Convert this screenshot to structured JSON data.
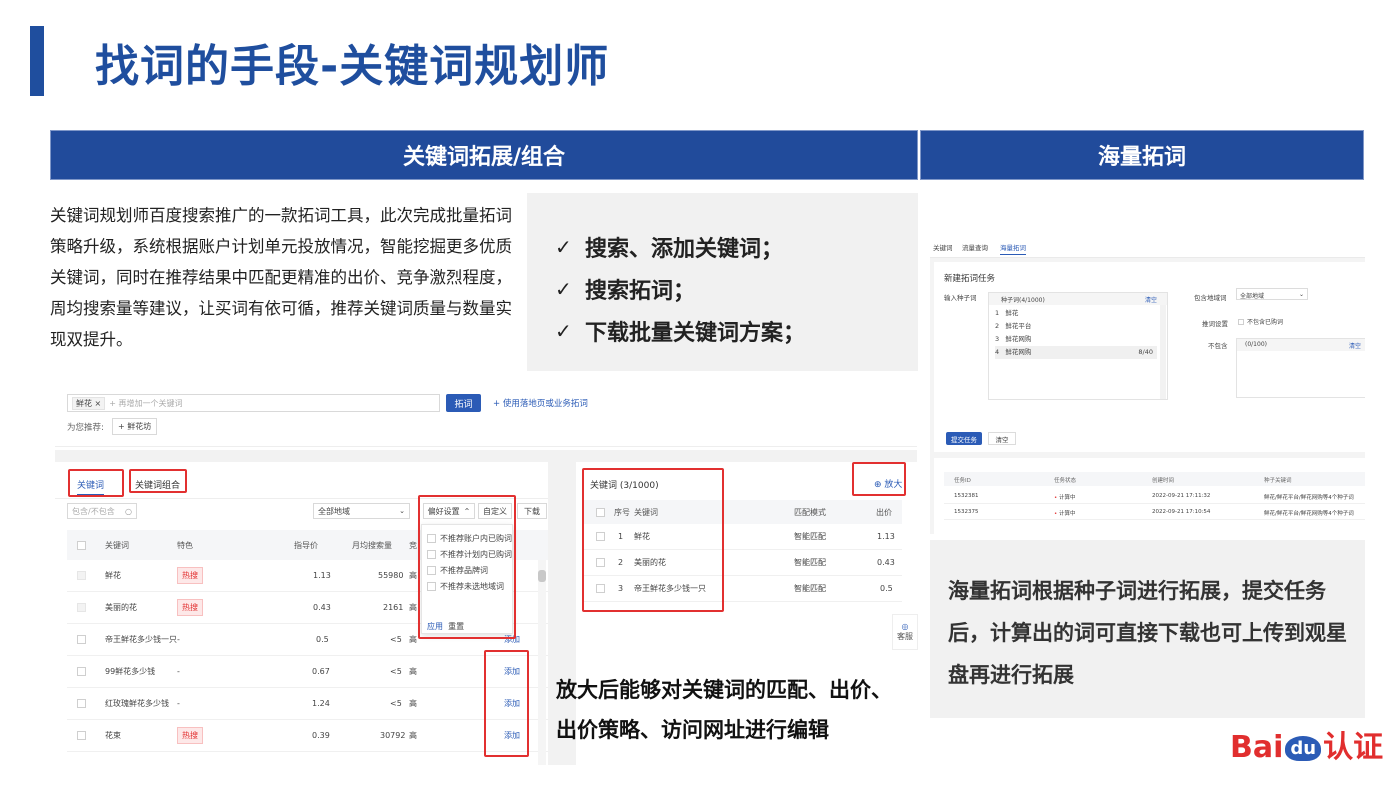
{
  "title": "找词的手段-关键词规划师",
  "sections": {
    "left_header": "关键词拓展/组合",
    "right_header": "海量拓词"
  },
  "description": "关键词规划师百度搜索推广的一款拓词工具，此次完成批量拓词策略升级，系统根据账户计划单元投放情况，智能挖掘更多优质关键词，同时在推荐结果中匹配更精准的出价、竞争激烈程度，周均搜索量等建议，让买词有依可循，推荐关键词质量与数量实现双提升。",
  "features": [
    "搜索、添加关键词；",
    "搜索拓词；",
    "下载批量关键词方案；"
  ],
  "check_mark": "✓",
  "search_panel": {
    "tag": "鲜花",
    "tag_close": "×",
    "placeholder": "+ 再增加一个关键词",
    "expand_button": "拓词",
    "landing_link": "+ 使用落地页或业务拓词",
    "recommend_label": "为您推荐:",
    "recommend_chip": "+ 鲜花坊"
  },
  "left_table": {
    "tabs": [
      "关键词",
      "关键词组合"
    ],
    "filter_placeholder": "包含/不包含",
    "region_select": "全部地域",
    "pref_button": "偏好设置",
    "custom_button": "自定义",
    "download_button": "下载",
    "columns": [
      "关键词",
      "特色",
      "指导价",
      "月均搜索量",
      "竞"
    ],
    "rows": [
      {
        "kw": "鲜花",
        "tag": "热搜",
        "price": "1.13",
        "vol": "55980",
        "comp": "高",
        "action": ""
      },
      {
        "kw": "美丽的花",
        "tag": "热搜",
        "price": "0.43",
        "vol": "2161",
        "comp": "高",
        "action": ""
      },
      {
        "kw": "帝王鲜花多少钱一只",
        "tag": "-",
        "price": "0.5",
        "vol": "<5",
        "comp": "高",
        "action": "添加"
      },
      {
        "kw": "99鲜花多少钱",
        "tag": "-",
        "price": "0.67",
        "vol": "<5",
        "comp": "高",
        "action": "添加"
      },
      {
        "kw": "红玫瑰鲜花多少钱",
        "tag": "-",
        "price": "1.24",
        "vol": "<5",
        "comp": "高",
        "action": "添加"
      },
      {
        "kw": "花束",
        "tag": "热搜",
        "price": "0.39",
        "vol": "30792",
        "comp": "高",
        "action": "添加"
      }
    ],
    "dropdown": {
      "options": [
        "不推荐账户内已购词",
        "不推荐计划内已购词",
        "不推荐品牌词",
        "不推荐未选地域词"
      ],
      "apply": "应用",
      "reset": "重置"
    }
  },
  "right_table": {
    "title": "关键词",
    "count": "(3/1000)",
    "zoom": "放大",
    "columns": [
      "序号",
      "关键词",
      "匹配模式",
      "出价"
    ],
    "rows": [
      {
        "no": "1",
        "kw": "鲜花",
        "match": "智能匹配",
        "bid": "1.13"
      },
      {
        "no": "2",
        "kw": "美丽的花",
        "match": "智能匹配",
        "bid": "0.43"
      },
      {
        "no": "3",
        "kw": "帝王鲜花多少钱一只",
        "match": "智能匹配",
        "bid": "0.5"
      }
    ],
    "service": "客服"
  },
  "bottom_note_lines": [
    "放大后能够对关键词的匹配、出价、",
    "出价策略、访问网址进行编辑"
  ],
  "mass_panel": {
    "tabs": [
      "关键词",
      "流量查询",
      "海量拓词"
    ],
    "heading": "新建拓词任务",
    "seed_label": "输入种子词",
    "seed_header": "种子词(4/1000)",
    "seed_clear": "清空",
    "seeds": [
      "鲜花",
      "鲜花平台",
      "鲜花网购",
      "鲜花网购"
    ],
    "seed_count": "8/40",
    "region_label": "包含地域词",
    "region_value": "全部地域",
    "setting_label": "推词设置",
    "setting_option": "不包含已购词",
    "exclude_label": "不包含",
    "exclude_count": "(0/100)",
    "exclude_clear": "清空",
    "submit": "提交任务",
    "clear": "清空",
    "task_columns": [
      "任务ID",
      "任务状态",
      "创建时间",
      "种子关键词"
    ],
    "tasks": [
      {
        "id": "1532381",
        "status": "计算中",
        "time": "2022-09-21 17:11:32",
        "seeds": "鲜花/鲜花平台/鲜花网购等4个种子词"
      },
      {
        "id": "1532375",
        "status": "计算中",
        "time": "2022-09-21 17:10:54",
        "seeds": "鲜花/鲜花平台/鲜花网购等4个种子词"
      }
    ]
  },
  "right_note": "海量拓词根据种子词进行拓展，提交任务后，计算出的词可直接下载也可上传到观星盘再进行拓展",
  "logo": {
    "bai": "Bai",
    "du": "du",
    "cert": "认证"
  },
  "colors": {
    "brand_blue": "#214b9b",
    "highlight_red": "#e23030",
    "link_blue": "#2b5bb6",
    "logo_red": "#e12e2e"
  }
}
